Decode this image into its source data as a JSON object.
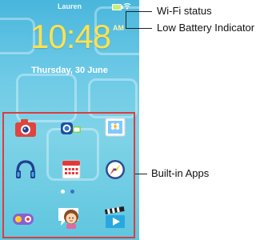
{
  "device": {
    "username": "Lauren",
    "time": "10:48",
    "ampm": "AM",
    "date": "Thursday, 30 June"
  },
  "apps": [
    {
      "name": "camera-app-icon"
    },
    {
      "name": "video-camera-app-icon"
    },
    {
      "name": "photo-gallery-app-icon"
    },
    {
      "name": "music-headphones-app-icon"
    },
    {
      "name": "calendar-app-icon"
    },
    {
      "name": "compass-app-icon"
    },
    {
      "name": "game-controller-app-icon"
    },
    {
      "name": "avatar-chat-app-icon"
    },
    {
      "name": "movie-clapper-app-icon"
    }
  ],
  "callouts": {
    "wifi": "Wi-Fi status",
    "battery": "Low Battery Indicator",
    "apps": "Built-in Apps"
  },
  "colors": {
    "highlight": "#e23a3a",
    "clock": "#ffe24d",
    "battery_fill": "#c6f07a"
  }
}
